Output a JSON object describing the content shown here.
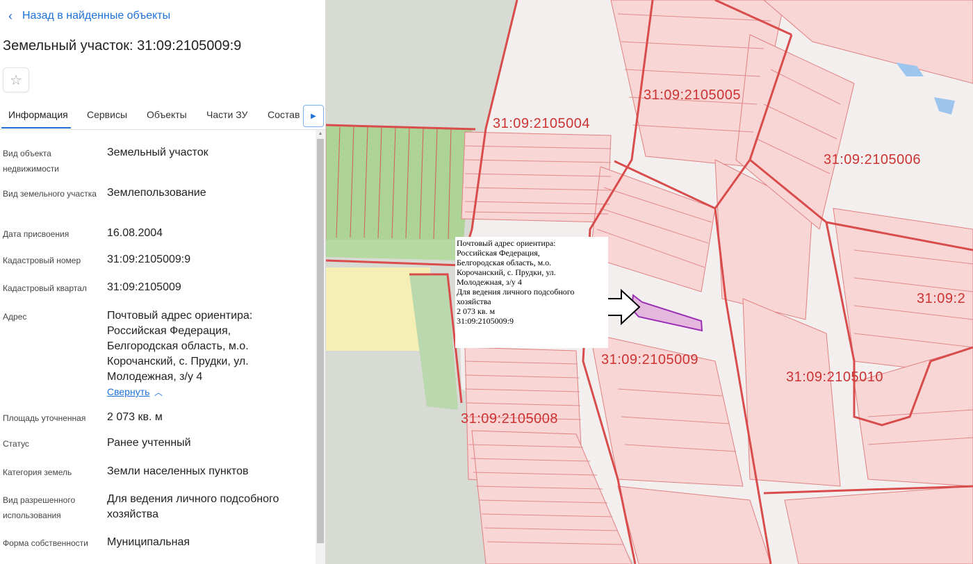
{
  "nav": {
    "back_label": "Назад в найденные объекты"
  },
  "header": {
    "title": "Земельный участок: 31:09:2105009:9"
  },
  "tabs": [
    {
      "label": "Информация"
    },
    {
      "label": "Сервисы"
    },
    {
      "label": "Объекты"
    },
    {
      "label": "Части ЗУ"
    },
    {
      "label": "Состав"
    }
  ],
  "info": {
    "object_type": {
      "label": "Вид объекта недвижимости",
      "value": "Земельный участок"
    },
    "parcel_type": {
      "label": "Вид земельного участка",
      "value": "Землепользование"
    },
    "assign_date": {
      "label": "Дата присвоения",
      "value": "16.08.2004"
    },
    "cadastral_number": {
      "label": "Кадастровый номер",
      "value": "31:09:2105009:9"
    },
    "cadastral_quarter": {
      "label": "Кадастровый квартал",
      "value": "31:09:2105009"
    },
    "address": {
      "label": "Адрес",
      "value": "Почтовый адрес ориентира: Российская Федерация, Белгородская область, м.о. Корочанский, с. Прудки, ул. Молодежная, з/у 4",
      "collapse_label": "Свернуть"
    },
    "area": {
      "label": "Площадь уточненная",
      "value": "2 073 кв. м"
    },
    "status": {
      "label": "Статус",
      "value": "Ранее учтенный"
    },
    "category": {
      "label": "Категория земель",
      "value": "Земли населенных пунктов"
    },
    "permitted_use": {
      "label": "Вид разрешенного использования",
      "value": "Для ведения личного подсобного хозяйства"
    },
    "ownership": {
      "label": "Форма собственности",
      "value": "Муниципальная"
    }
  },
  "map": {
    "quarters": {
      "q4": "31:09:2105004",
      "q5": "31:09:2105005",
      "q6": "31:09:2105006",
      "q9": "31:09:2105009",
      "q10": "31:09:2105010",
      "q8": "31:09:2105008",
      "q2_partial": "31:09:2"
    },
    "popup": {
      "line1": "Почтовый адрес ориентира:",
      "line2": "Российская Федерация,",
      "line3": "Белгородская область, м.о.",
      "line4": "Корочанский, с. Прудки, ул.",
      "line5": "Молодежная, з/у 4",
      "line6": "Для ведения личного подсобного",
      "line7": "хозяйства",
      "line8": "2 073 кв. м",
      "line9": "31:09:2105009:9"
    },
    "colors": {
      "boundary": "#d94c4c",
      "parcel_fill": "#f8d6d6",
      "selected": "#9b30b5",
      "green": "#a9d18e",
      "yellow": "#f5efb5",
      "grey": "#d8dad4"
    }
  }
}
